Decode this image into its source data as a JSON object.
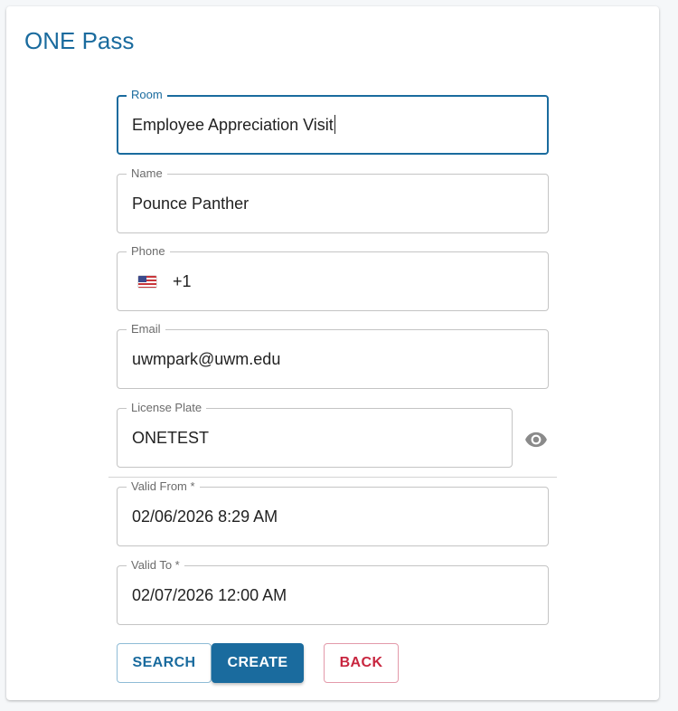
{
  "app": {
    "title": "ONE Pass"
  },
  "form": {
    "room": {
      "label": "Room",
      "value": "Employee Appreciation Visit"
    },
    "name": {
      "label": "Name",
      "value": "Pounce Panther"
    },
    "phone": {
      "label": "Phone",
      "country": "flag-us-icon",
      "code": "+1"
    },
    "email": {
      "label": "Email",
      "value": "uwmpark@uwm.edu"
    },
    "license_plate": {
      "label": "License Plate",
      "value": "ONETEST",
      "toggle_icon": "eye-icon"
    },
    "valid_from": {
      "label": "Valid From *",
      "value": "02/06/2026 8:29 AM"
    },
    "valid_to": {
      "label": "Valid To *",
      "value": "02/07/2026 12:00 AM"
    }
  },
  "actions": {
    "search_label": "Search",
    "create_label": "Create",
    "back_label": "Back"
  },
  "colors": {
    "primary": "#1a6b9e",
    "danger": "#c8263f",
    "background": "#f5f7f9"
  }
}
